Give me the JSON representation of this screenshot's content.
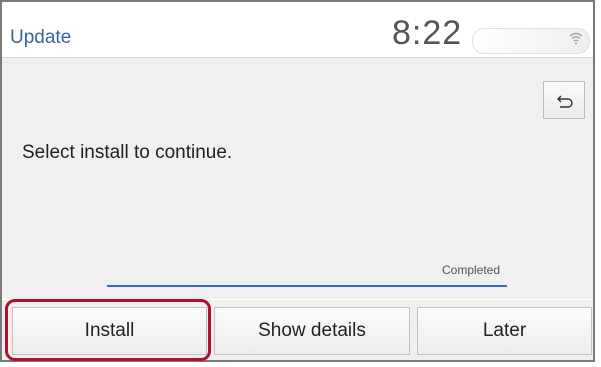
{
  "header": {
    "title": "Update",
    "clock": "8:22",
    "status_icons": [
      "wifi-icon"
    ]
  },
  "main": {
    "back_icon": "back-arrow-icon",
    "message": "Select install to continue.",
    "progress": {
      "label": "Completed",
      "percent": 100,
      "color": "#3d66c6"
    }
  },
  "footer": {
    "buttons": [
      {
        "label": "Install"
      },
      {
        "label": "Show details"
      },
      {
        "label": "Later"
      }
    ]
  },
  "colors": {
    "accent": "#3b63a8",
    "highlight": "#b2102f"
  }
}
